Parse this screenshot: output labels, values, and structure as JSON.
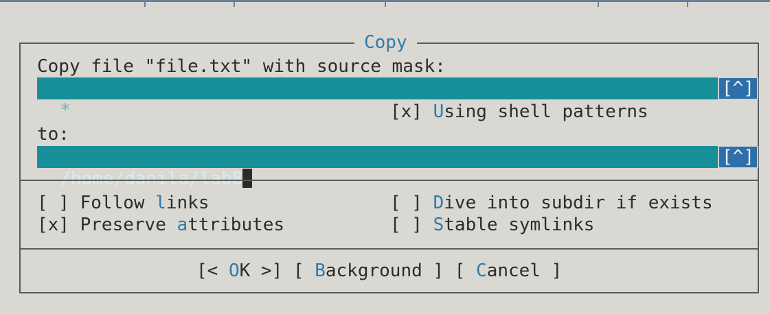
{
  "dialog": {
    "title": "Copy",
    "source_label": "Copy file \"file.txt\" with source mask:",
    "source_value": "*",
    "history_button": "[^]",
    "shell_patterns": {
      "mark": "[x] ",
      "hot": "U",
      "rest": "sing shell patterns"
    },
    "to_label": "to:",
    "dest_value": "/home/danila/lab8"
  },
  "options": {
    "follow_links": {
      "mark": "[ ] ",
      "pre": "Follow ",
      "hot": "l",
      "post": "inks"
    },
    "preserve_attributes": {
      "mark": "[x] ",
      "pre": "Preserve ",
      "hot": "a",
      "post": "ttributes"
    },
    "dive_into_subdir": {
      "mark": "[ ] ",
      "pre": "",
      "hot": "D",
      "post": "ive into subdir if exists"
    },
    "stable_symlinks": {
      "mark": "[ ] ",
      "pre": "",
      "hot": "S",
      "post": "table symlinks"
    }
  },
  "buttons": {
    "ok": {
      "pre": "[< ",
      "hot": "O",
      "post": "K >]"
    },
    "background": {
      "pre": "[ ",
      "hot": "B",
      "post": "ackground ]"
    },
    "cancel": {
      "pre": "[ ",
      "hot": "C",
      "post": "ancel ]"
    }
  },
  "colors": {
    "background": "#d9d8d2",
    "input_bg": "#168f99",
    "hotkey": "#2f7bab",
    "border": "#5a5a5a"
  }
}
